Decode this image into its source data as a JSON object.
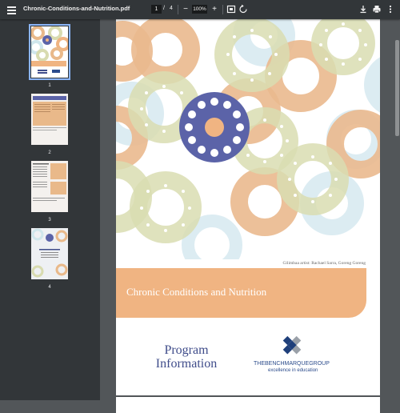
{
  "toolbar": {
    "file_name": "Chronic-Conditions-and-Nutrition.pdf",
    "current_page": "1",
    "page_separator": "/",
    "total_pages": "4",
    "zoom_value": "100%",
    "zoom_out_symbol": "−",
    "zoom_in_symbol": "+"
  },
  "sidebar": {
    "thumbnails": [
      {
        "label": "1"
      },
      {
        "label": "2"
      },
      {
        "label": "3"
      },
      {
        "label": "4"
      }
    ]
  },
  "cover": {
    "artist_credit": "Gilimbaa artist: Rachael Sarra, Goreng Goreng",
    "title": "Chronic Conditions and Nutrition",
    "program_line1": "Program",
    "program_line2": "Information",
    "logo_name": "THEBENCHMARQUEGROUP",
    "logo_tagline": "excellence in education"
  },
  "colors": {
    "toolbar_bg": "#323639",
    "viewer_bg": "#525659",
    "band_orange": "#f0b482",
    "title_blue": "#3f4c8a",
    "selected_outline": "#8ab4f8"
  }
}
